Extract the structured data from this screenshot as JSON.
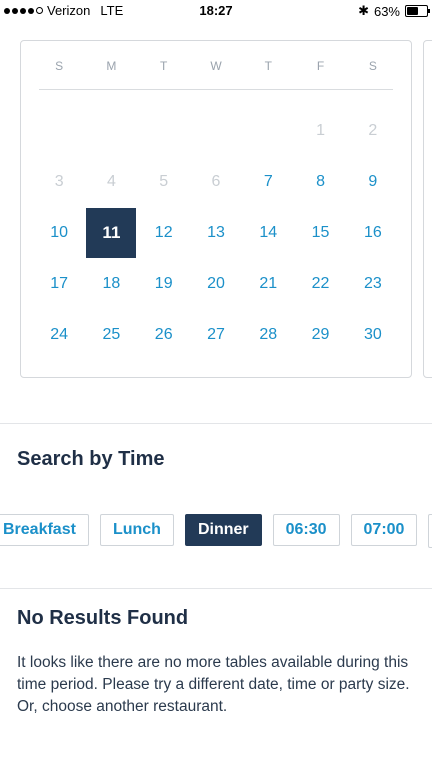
{
  "status_bar": {
    "carrier": "Verizon",
    "network": "LTE",
    "time": "18:27",
    "battery": "63%",
    "battery_level": 0.63
  },
  "calendar": {
    "weekdays": [
      "S",
      "M",
      "T",
      "W",
      "T",
      "F",
      "S"
    ],
    "weeks": [
      [
        "",
        "",
        "",
        "",
        "",
        "1",
        "2"
      ],
      [
        "3",
        "4",
        "5",
        "6",
        "7",
        "8",
        "9"
      ],
      [
        "10",
        "11",
        "12",
        "13",
        "14",
        "15",
        "16"
      ],
      [
        "17",
        "18",
        "19",
        "20",
        "21",
        "22",
        "23"
      ],
      [
        "24",
        "25",
        "26",
        "27",
        "28",
        "29",
        "30"
      ]
    ],
    "disabled_days": [
      "1",
      "2",
      "3",
      "4",
      "5",
      "6"
    ],
    "selected_day": "11"
  },
  "search_by_time": {
    "title": "Search by Time",
    "options": [
      "Breakfast",
      "Lunch",
      "Dinner",
      "06:30",
      "07:00"
    ],
    "selected": "Dinner"
  },
  "no_results": {
    "title": "No Results Found",
    "message": "It looks like there are no more tables available during this time period. Please try a different date, time or party size. Or, choose another restaurant."
  },
  "colors": {
    "accent": "#1b90c9",
    "selected_bg": "#223a57",
    "disabled": "#c9ced3"
  }
}
